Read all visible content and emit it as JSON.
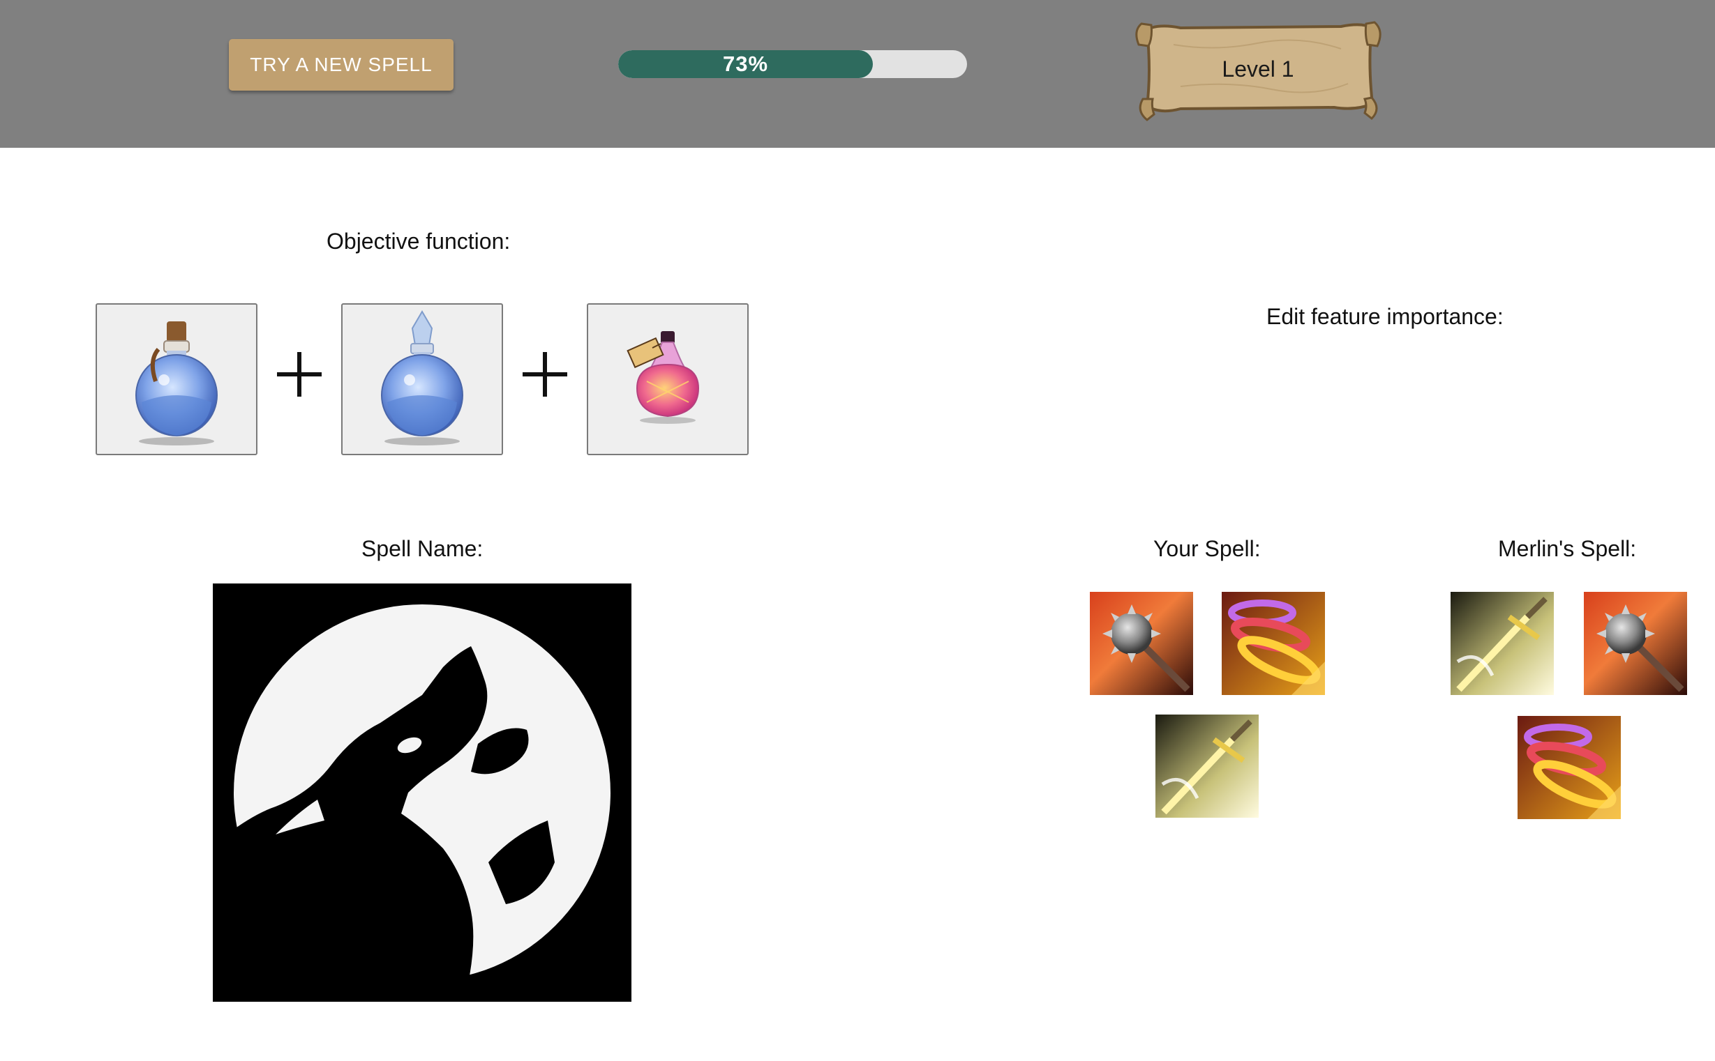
{
  "header": {
    "try_button_label": "TRY A NEW SPELL",
    "progress_percent": 73,
    "progress_label": "73%",
    "level_label": "Level 1",
    "progress_color": "#2e6b5e",
    "button_color": "#c0a070"
  },
  "objective": {
    "title": "Objective function:",
    "potions": [
      "blue-round-potion-cork-icon",
      "blue-round-potion-crystal-icon",
      "pink-potion-tag-icon"
    ]
  },
  "feature_importance": {
    "title": "Edit feature importance:"
  },
  "spell": {
    "name_title": "Spell Name:",
    "image_icon": "wolf-howling-moon-icon"
  },
  "your_spell": {
    "title": "Your Spell:",
    "abilities": [
      "spiked-mace-icon",
      "spiral-vortex-icon",
      "golden-sword-icon"
    ]
  },
  "merlin_spell": {
    "title": "Merlin's Spell:",
    "abilities": [
      "golden-sword-icon",
      "spiked-mace-icon",
      "spiral-vortex-icon"
    ]
  }
}
